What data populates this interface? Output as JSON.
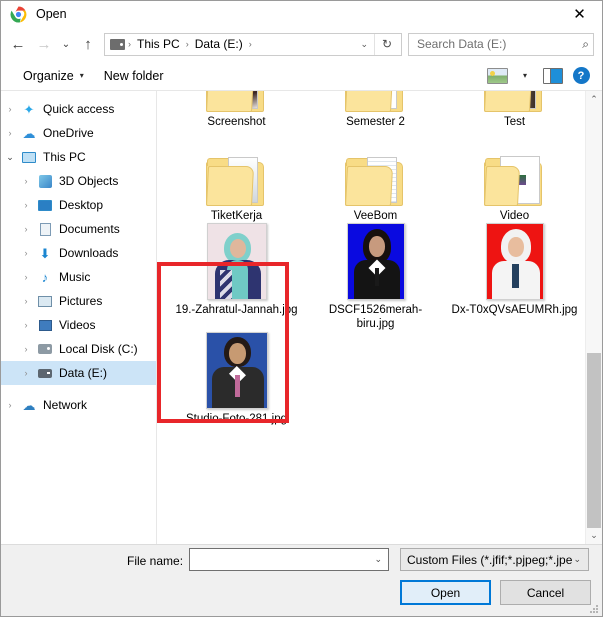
{
  "window": {
    "title": "Open",
    "app_icon": "chrome-icon",
    "close_label": "✕"
  },
  "navbar": {
    "back_icon": "←",
    "forward_icon": "→",
    "recent_icon": "⌄",
    "up_icon": "↑",
    "breadcrumb": [
      {
        "label": "This PC"
      },
      {
        "label": "Data (E:)"
      }
    ],
    "breadcrumb_sep": "›",
    "dropdown_icon": "⌄",
    "refresh_icon": "↻",
    "search_placeholder": "Search Data (E:)",
    "search_value": "",
    "search_icon": "⌕"
  },
  "toolbar": {
    "organize_label": "Organize",
    "organize_caret": "▾",
    "new_folder_label": "New folder",
    "view_caret": "▾",
    "help_label": "?"
  },
  "sidebar": {
    "items": [
      {
        "label": "Quick access",
        "icon": "star-icon",
        "expander": "›",
        "indent": 0,
        "selected": false
      },
      {
        "label": "OneDrive",
        "icon": "cloud-icon",
        "expander": "›",
        "indent": 0,
        "selected": false
      },
      {
        "label": "This PC",
        "icon": "computer-icon",
        "expander": "⌄",
        "indent": 0,
        "selected": false,
        "expanded": true
      },
      {
        "label": "3D Objects",
        "icon": "cube-icon",
        "expander": "›",
        "indent": 1,
        "selected": false
      },
      {
        "label": "Desktop",
        "icon": "desktop-icon",
        "expander": "›",
        "indent": 1,
        "selected": false
      },
      {
        "label": "Documents",
        "icon": "documents-icon",
        "expander": "›",
        "indent": 1,
        "selected": false
      },
      {
        "label": "Downloads",
        "icon": "download-icon",
        "expander": "›",
        "indent": 1,
        "selected": false
      },
      {
        "label": "Music",
        "icon": "music-icon",
        "expander": "›",
        "indent": 1,
        "selected": false
      },
      {
        "label": "Pictures",
        "icon": "pictures-icon",
        "expander": "›",
        "indent": 1,
        "selected": false
      },
      {
        "label": "Videos",
        "icon": "videos-icon",
        "expander": "›",
        "indent": 1,
        "selected": false
      },
      {
        "label": "Local Disk (C:)",
        "icon": "disk-icon",
        "expander": "›",
        "indent": 1,
        "selected": false
      },
      {
        "label": "Data (E:)",
        "icon": "drive-icon",
        "expander": "›",
        "indent": 1,
        "selected": true
      },
      {
        "label": "Network",
        "icon": "network-icon",
        "expander": "›",
        "indent": 0,
        "selected": false
      }
    ]
  },
  "files": {
    "rows": [
      [
        {
          "name": "Screenshot",
          "type": "folder"
        },
        {
          "name": "Semester 2",
          "type": "folder"
        },
        {
          "name": "Test",
          "type": "folder"
        }
      ],
      [
        {
          "name": "TiketKerja",
          "type": "folder"
        },
        {
          "name": "VeeBom",
          "type": "folder"
        },
        {
          "name": "Video",
          "type": "folder"
        }
      ],
      [
        {
          "name": "19.-Zahratul-Jannah.jpg",
          "type": "image",
          "highlighted": true
        },
        {
          "name": "DSCF1526merah-biru.jpg",
          "type": "image",
          "highlighted": false
        },
        {
          "name": "Dx-T0xQVsAEUMRh.jpg",
          "type": "image",
          "highlighted": false
        }
      ],
      [
        {
          "name": "Studio-Foto-281.jpg",
          "type": "image",
          "highlighted": false
        }
      ]
    ]
  },
  "scrollbar": {
    "up_icon": "⌃",
    "down_icon": "⌄"
  },
  "footer": {
    "file_name_label": "File name:",
    "file_name_value": "",
    "file_name_chevron": "⌄",
    "filter_value": "Custom Files (*.jfif;*.pjpeg;*.jpe",
    "filter_chevron": "⌄",
    "open_label": "Open",
    "cancel_label": "Cancel"
  },
  "colors": {
    "accent": "#0078d7",
    "selection": "#cce4f7",
    "annotation": "#e8262a",
    "folder": "#f8dc86"
  }
}
